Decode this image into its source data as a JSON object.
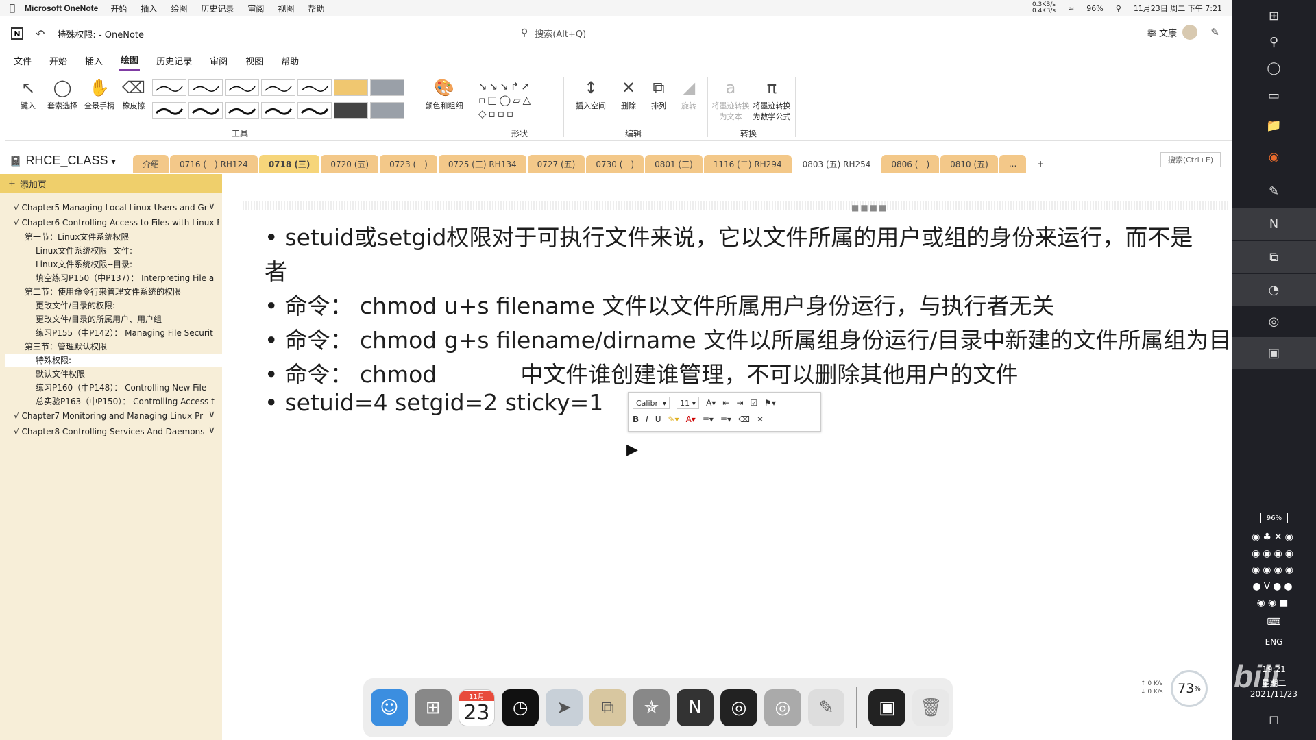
{
  "menubar": {
    "app": "Microsoft OneNote",
    "items": [
      "开始",
      "插入",
      "绘图",
      "历史记录",
      "审阅",
      "视图",
      "帮助"
    ],
    "net_up": "0.3KB/s",
    "net_down": "0.4KB/s",
    "battery": "96%",
    "datetime": "11月23日 周二 下午 7:21"
  },
  "titlebar": {
    "doc_title": "特殊权限:",
    "app_suffix": "- OneNote",
    "search_placeholder": "搜索(Alt+Q)",
    "user": "季 文康"
  },
  "ribbon_tabs": [
    {
      "label": "文件",
      "active": false
    },
    {
      "label": "开始",
      "active": false
    },
    {
      "label": "插入",
      "active": false
    },
    {
      "label": "绘图",
      "active": true
    },
    {
      "label": "历史记录",
      "active": false
    },
    {
      "label": "审阅",
      "active": false
    },
    {
      "label": "视图",
      "active": false
    },
    {
      "label": "帮助",
      "active": false
    }
  ],
  "ribbon": {
    "type_label": "键入",
    "lasso_label": "套索选择",
    "pan_label": "全景手柄",
    "eraser_label": "橡皮擦",
    "color_label": "颜色和粗细",
    "tools_group": "工具",
    "shapes_group": "形状",
    "insert_space_label": "插入空间",
    "delete_label": "删除",
    "arrange_label": "排列",
    "rotate_label": "旋转",
    "edit_group": "编辑",
    "ink_to_text_label": "将墨迹转换为文本",
    "ink_to_math_label": "将墨迹转换为数学公式",
    "convert_group": "转换"
  },
  "notebook": {
    "name": "RHCE_CLASS",
    "search_section": "搜索(Ctrl+E)",
    "tabs": [
      {
        "label": "介绍",
        "color": "#f3c889"
      },
      {
        "label": "0716 (一) RH124",
        "color": "#f3c889"
      },
      {
        "label": "0718 (三)",
        "color": "#f6d57a",
        "active": true
      },
      {
        "label": "0720 (五)",
        "color": "#f3c889"
      },
      {
        "label": "0723 (一)",
        "color": "#f3c889"
      },
      {
        "label": "0725 (三) RH134",
        "color": "#f3c889"
      },
      {
        "label": "0727 (五)",
        "color": "#f3c889"
      },
      {
        "label": "0730 (一)",
        "color": "#f3c889"
      },
      {
        "label": "0801 (三)",
        "color": "#f3c889"
      },
      {
        "label": "1116 (二) RH294",
        "color": "#f3c889"
      },
      {
        "label": "0803 (五) RH254",
        "color": "#ffffff"
      },
      {
        "label": "0806 (一)",
        "color": "#f3c889"
      },
      {
        "label": "0810 (五)",
        "color": "#f3c889"
      },
      {
        "label": "...",
        "color": "#f3c889"
      },
      {
        "label": "+",
        "color": "#ffffff"
      }
    ]
  },
  "pages": {
    "add_page": "添加页",
    "items": [
      {
        "label": "Chapter5 Managing Local Linux Users and Gr",
        "indent": 0,
        "chevron": true
      },
      {
        "label": "Chapter6 Controlling Access to Files with Linux F",
        "indent": 0,
        "chevron": false
      },
      {
        "label": "第一节：Linux文件系统权限",
        "indent": 1
      },
      {
        "label": "Linux文件系统权限--文件:",
        "indent": 2
      },
      {
        "label": "Linux文件系统权限--目录:",
        "indent": 2
      },
      {
        "label": "填空练习P150（中P137）： Interpreting File a",
        "indent": 2
      },
      {
        "label": "第二节：使用命令行来管理文件系统的权限",
        "indent": 1
      },
      {
        "label": "更改文件/目录的权限:",
        "indent": 2
      },
      {
        "label": "更改文件/目录的所属用户、用户组",
        "indent": 2
      },
      {
        "label": "练习P155（中P142）： Managing File Securit",
        "indent": 2
      },
      {
        "label": "第三节：管理默认权限",
        "indent": 1
      },
      {
        "label": "特殊权限:",
        "indent": 2,
        "selected": true
      },
      {
        "label": "默认文件权限",
        "indent": 2
      },
      {
        "label": "练习P160（中P148）： Controlling New File",
        "indent": 2
      },
      {
        "label": "总实验P163（中P150）： Controlling Access t",
        "indent": 2
      },
      {
        "label": "Chapter7 Monitoring and Managing Linux Pr",
        "indent": 0,
        "chevron": true
      },
      {
        "label": "Chapter8 Controlling Services And Daemons",
        "indent": 0,
        "chevron": true
      }
    ]
  },
  "content": {
    "lines": [
      "setuid或setgid权限对于可执行文件来说，它以文件所属的用户或组的身份来运行，而不是",
      "者",
      "命令：  chmod u+s filename 文件以文件所属用户身份运行，与执行者无关",
      "命令：  chmod g+s filename/dirname 文件以所属组身份运行/目录中新建的文件所属组为目",
      "命令：  chmod",
      "中文件谁创建谁管理，不可以删除其他用户的文件",
      "setuid=4 setgid=2 sticky=1"
    ],
    "mini_toolbar": {
      "font": "Calibri",
      "size": "11",
      "bold": "B",
      "italic": "I",
      "underline": "U"
    }
  },
  "taskbar_right": {
    "battery": "96%",
    "lang": "ENG",
    "time": "19:21",
    "weekday": "星期二",
    "date": "2021/11/23"
  },
  "dock": {
    "calendar_month": "11月",
    "calendar_day": "23",
    "perf_percent": "73",
    "net_up": "0 K/s",
    "net_down": "0 K/s"
  }
}
